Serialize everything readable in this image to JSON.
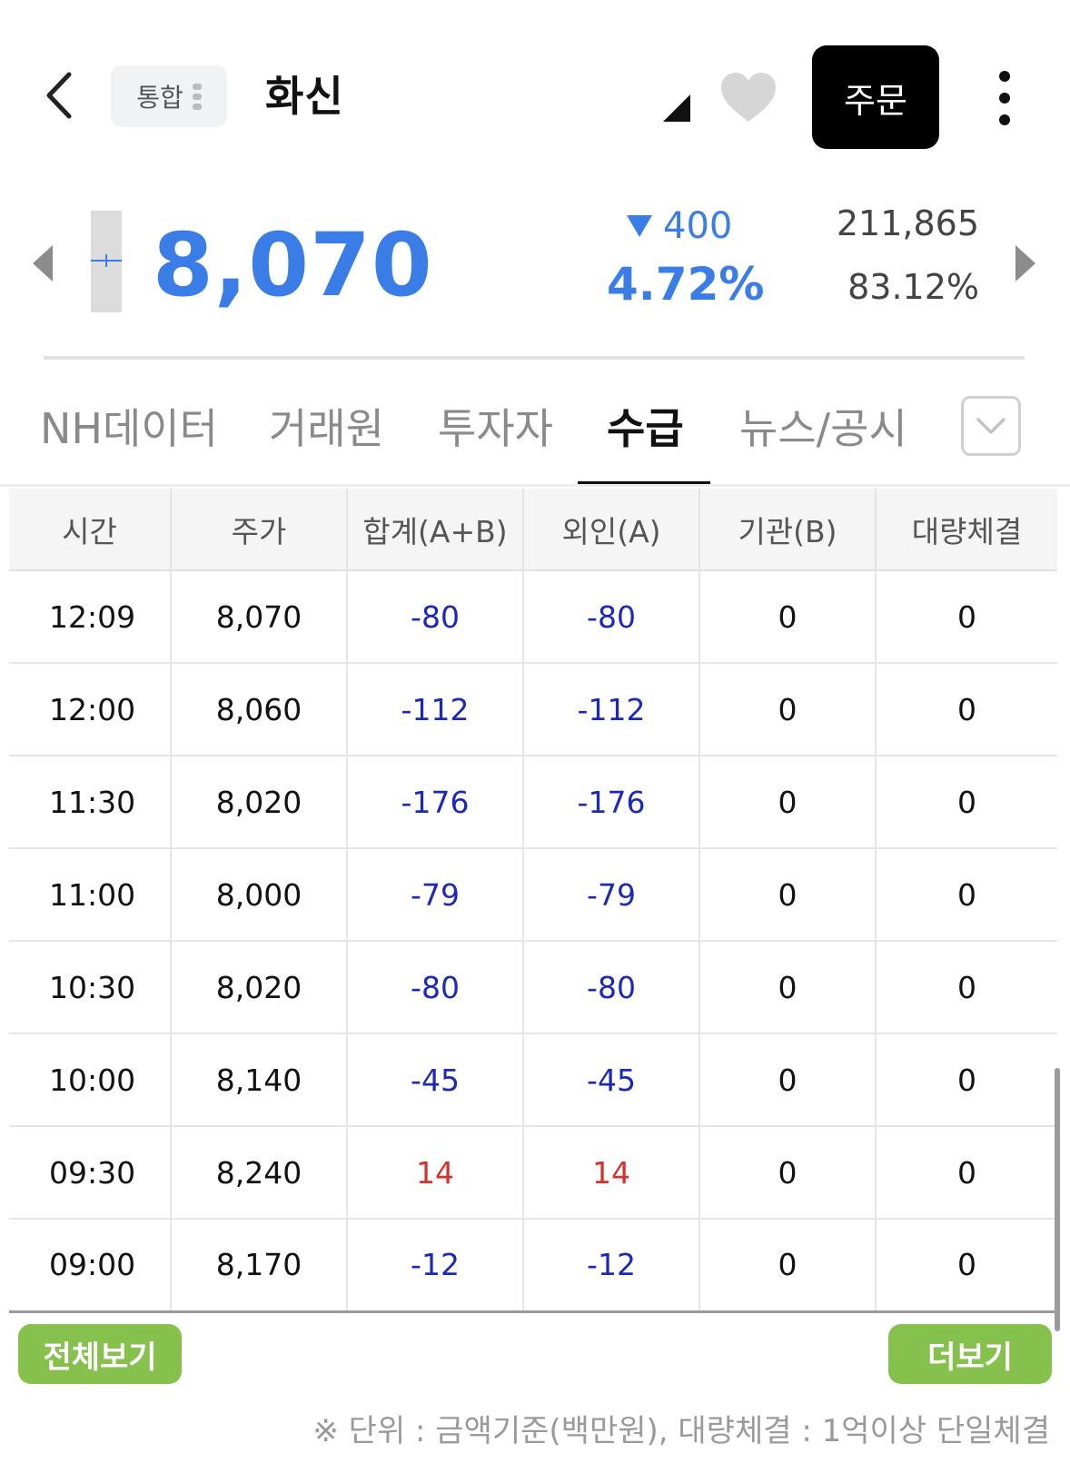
{
  "header": {
    "market_chip": "통합",
    "stock_name": "화신",
    "order_label": "주문",
    "icons": [
      "back-icon",
      "drag-handle-icon",
      "corner-triangle-icon",
      "heart-icon",
      "more-vertical-icon"
    ]
  },
  "price": {
    "current": "8,070",
    "change_value": "400",
    "change_pct": "4.72%",
    "volume": "211,865",
    "volume_ratio": "83.12%",
    "down_color": "#3b7de6"
  },
  "tabs": [
    {
      "label": "NH데이터"
    },
    {
      "label": "거래원"
    },
    {
      "label": "투자자"
    },
    {
      "label": "수급"
    },
    {
      "label": "뉴스/공시"
    }
  ],
  "active_tab": "수급",
  "table": {
    "headers": [
      "시간",
      "주가",
      "합계(A+B)",
      "외인(A)",
      "기관(B)",
      "대량체결"
    ],
    "rows": [
      [
        "12:09",
        "8,070",
        "-80",
        "-80",
        "0",
        "0"
      ],
      [
        "12:00",
        "8,060",
        "-112",
        "-112",
        "0",
        "0"
      ],
      [
        "11:30",
        "8,020",
        "-176",
        "-176",
        "0",
        "0"
      ],
      [
        "11:00",
        "8,000",
        "-79",
        "-79",
        "0",
        "0"
      ],
      [
        "10:30",
        "8,020",
        "-80",
        "-80",
        "0",
        "0"
      ],
      [
        "10:00",
        "8,140",
        "-45",
        "-45",
        "0",
        "0"
      ],
      [
        "09:30",
        "8,240",
        "14",
        "14",
        "0",
        "0"
      ],
      [
        "09:00",
        "8,170",
        "-12",
        "-12",
        "0",
        "0"
      ]
    ],
    "negative_color": "#1c29b8",
    "positive_color": "#d7302a"
  },
  "buttons": {
    "view_all": "전체보기",
    "more": "더보기",
    "accent": "#86c14e"
  },
  "footnote": "※ 단위 : 금액기준(백만원), 대량체결 : 1억이상 단일체결"
}
